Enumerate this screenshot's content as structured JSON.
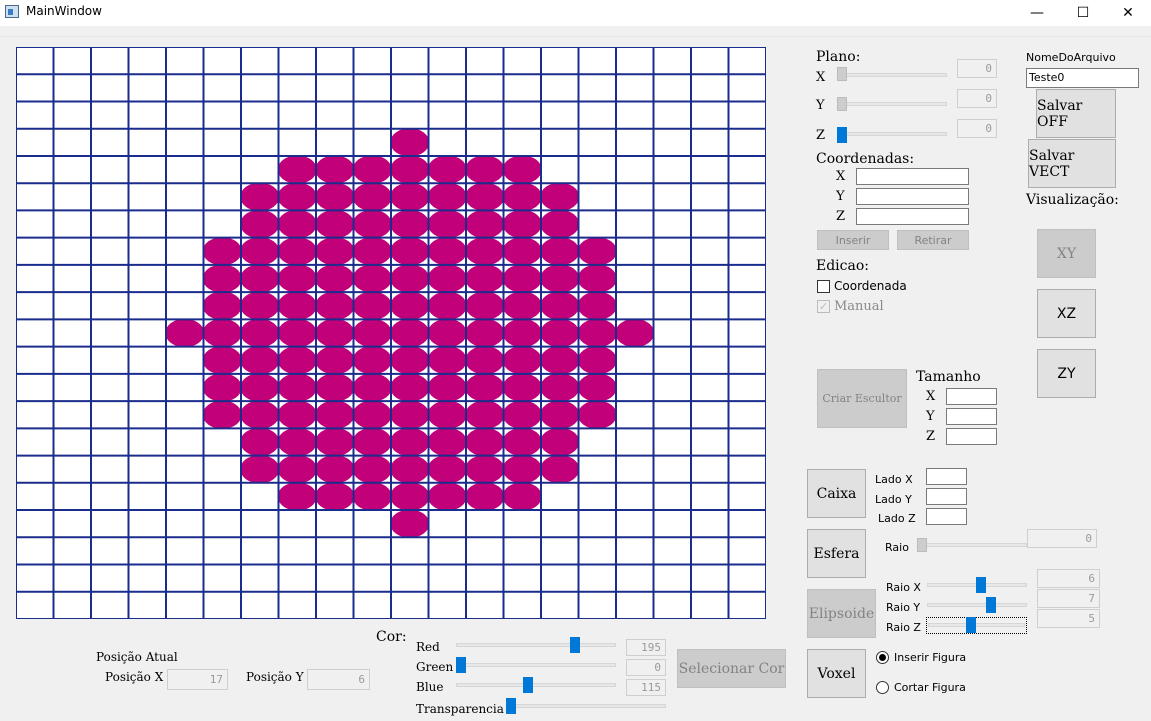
{
  "window": {
    "title": "MainWindow",
    "min_glyph": "—",
    "max_glyph": "☐",
    "close_glyph": "✕"
  },
  "colors": {
    "voxel": "#c2007a",
    "gridline": "#1a2c8c",
    "accent": "#0078d7"
  },
  "canvas": {
    "voxel_rows": [
      [],
      [],
      [],
      [
        10
      ],
      [
        7,
        8,
        9,
        10,
        11,
        12,
        13
      ],
      [
        6,
        7,
        8,
        9,
        10,
        11,
        12,
        13,
        14
      ],
      [
        6,
        7,
        8,
        9,
        10,
        11,
        12,
        13,
        14
      ],
      [
        5,
        6,
        7,
        8,
        9,
        10,
        11,
        12,
        13,
        14,
        15
      ],
      [
        5,
        6,
        7,
        8,
        9,
        10,
        11,
        12,
        13,
        14,
        15
      ],
      [
        5,
        6,
        7,
        8,
        9,
        10,
        11,
        12,
        13,
        14,
        15
      ],
      [
        4,
        5,
        6,
        7,
        8,
        9,
        10,
        11,
        12,
        13,
        14,
        15,
        16
      ],
      [
        5,
        6,
        7,
        8,
        9,
        10,
        11,
        12,
        13,
        14,
        15
      ],
      [
        5,
        6,
        7,
        8,
        9,
        10,
        11,
        12,
        13,
        14,
        15
      ],
      [
        5,
        6,
        7,
        8,
        9,
        10,
        11,
        12,
        13,
        14,
        15
      ],
      [
        6,
        7,
        8,
        9,
        10,
        11,
        12,
        13,
        14
      ],
      [
        6,
        7,
        8,
        9,
        10,
        11,
        12,
        13,
        14
      ],
      [
        7,
        8,
        9,
        10,
        11,
        12,
        13
      ],
      [
        10
      ],
      [],
      [],
      []
    ]
  },
  "plano": {
    "title": "Plano:",
    "x_label": "X",
    "y_label": "Y",
    "z_label": "Z",
    "x_value": "0",
    "y_value": "0",
    "z_value": "0"
  },
  "coordenadas": {
    "title": "Coordenadas:",
    "x_label": "X",
    "y_label": "Y",
    "z_label": "Z",
    "inserir_label": "Inserir",
    "retirar_label": "Retirar"
  },
  "edicao": {
    "title": "Edicao:",
    "coordenada_label": "Coordenada",
    "manual_label": "Manual"
  },
  "file": {
    "name_label": "NomeDoArquivo",
    "name_value": "Teste0",
    "salvar_off_label": "Salvar OFF",
    "salvar_vect_label": "Salvar VECT"
  },
  "visualizacao": {
    "title": "Visualização:",
    "xy_label": "XY",
    "xz_label": "XZ",
    "zy_label": "ZY"
  },
  "escultor": {
    "criar_label": "Criar Escultor",
    "tamanho_title": "Tamanho",
    "x_label": "X",
    "y_label": "Y",
    "z_label": "Z"
  },
  "caixa": {
    "button_label": "Caixa",
    "lado_x_label": "Lado X",
    "lado_y_label": "Lado Y",
    "lado_z_label": "Lado Z"
  },
  "esfera": {
    "button_label": "Esfera",
    "raio_label": "Raio",
    "raio_value": "0"
  },
  "elipsoide": {
    "button_label": "Elipsoide",
    "raio_x_label": "Raio X",
    "raio_y_label": "Raio Y",
    "raio_z_label": "Raio Z",
    "raio_x_value": "6",
    "raio_y_value": "7",
    "raio_z_value": "5"
  },
  "voxel": {
    "button_label": "Voxel",
    "inserir_label": "Inserir Figura",
    "cortar_label": "Cortar Figura"
  },
  "cor": {
    "title": "Cor:",
    "red_label": "Red",
    "green_label": "Green",
    "blue_label": "Blue",
    "transparencia_label": "Transparencia",
    "red_value": "195",
    "green_value": "0",
    "blue_value": "115",
    "selecionar_label": "Selecionar Cor"
  },
  "posicao": {
    "title": "Posição Atual",
    "x_label": "Posição X",
    "y_label": "Posição Y",
    "x_value": "17",
    "y_value": "6"
  }
}
